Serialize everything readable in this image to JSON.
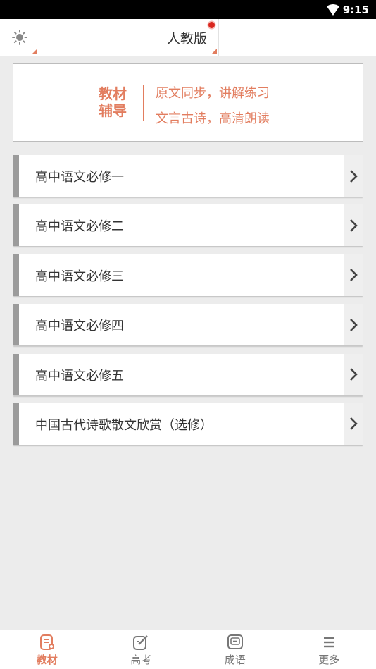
{
  "status_bar": {
    "time": "9:15"
  },
  "top_bar": {
    "version_label": "人教版"
  },
  "banner": {
    "title_line1": "教材",
    "title_line2": "辅导",
    "line1": "原文同步，讲解练习",
    "line2": "文言古诗，高清朗读"
  },
  "books": [
    {
      "title": "高中语文必修一"
    },
    {
      "title": "高中语文必修二"
    },
    {
      "title": "高中语文必修三"
    },
    {
      "title": "高中语文必修四"
    },
    {
      "title": "高中语文必修五"
    },
    {
      "title": "中国古代诗歌散文欣赏（选修）"
    }
  ],
  "tabs": [
    {
      "label": "教材",
      "icon": "textbook-icon",
      "active": true
    },
    {
      "label": "高考",
      "icon": "exam-edit-icon",
      "active": false
    },
    {
      "label": "成语",
      "icon": "idiom-book-icon",
      "active": false
    },
    {
      "label": "更多",
      "icon": "menu-icon",
      "active": false
    }
  ],
  "colors": {
    "accent": "#e27d5f",
    "badge": "#d9271f",
    "item_border": "#9b9b9b",
    "background": "#ececec"
  }
}
